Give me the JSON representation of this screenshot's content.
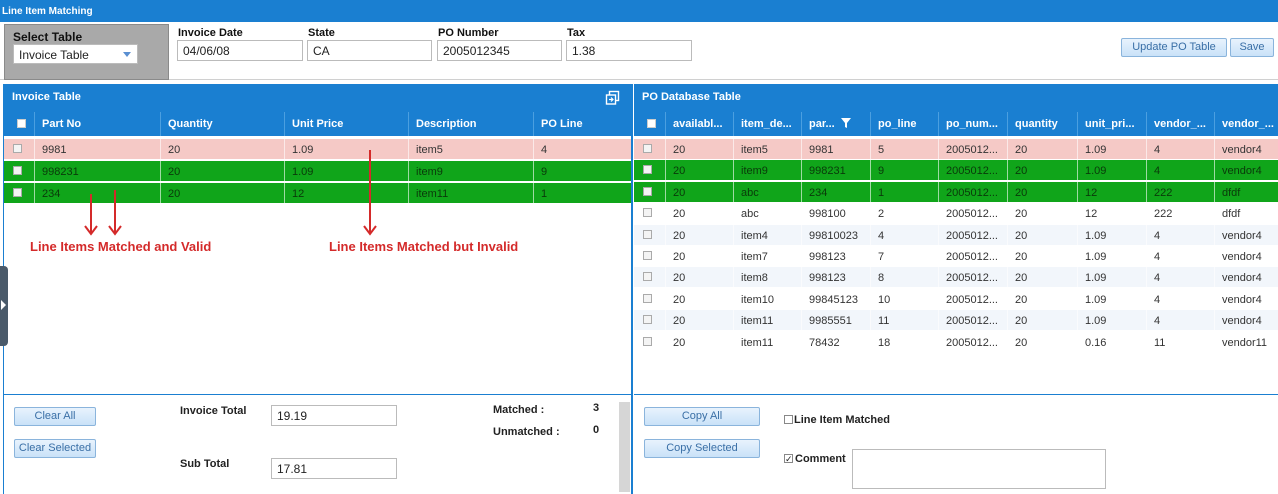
{
  "window": {
    "title": "Line Item Matching"
  },
  "select_table": {
    "label": "Select Table",
    "value": "Invoice Table"
  },
  "fields": {
    "invoice_date": {
      "label": "Invoice Date",
      "value": "04/06/08"
    },
    "state": {
      "label": "State",
      "value": "CA"
    },
    "po_number": {
      "label": "PO Number",
      "value": "2005012345"
    },
    "tax": {
      "label": "Tax",
      "value": "1.38"
    }
  },
  "toolbar": {
    "update_po_label": "Update PO Table",
    "save_label": "Save"
  },
  "invoice_table": {
    "title": "Invoice Table",
    "columns": [
      "Part No",
      "Quantity",
      "Unit Price",
      "Description",
      "PO Line"
    ],
    "rows": [
      {
        "state": "pink",
        "cells": [
          "9981",
          "20",
          "1.09",
          "item5",
          "4"
        ]
      },
      {
        "state": "green",
        "cells": [
          "998231",
          "20",
          "1.09",
          "item9",
          "9"
        ]
      },
      {
        "state": "green",
        "cells": [
          "234",
          "20",
          "12",
          "item11",
          "1"
        ]
      }
    ]
  },
  "annotations": {
    "valid": "Line Items Matched and Valid",
    "invalid": "Line Items Matched but Invalid"
  },
  "po_table": {
    "title": "PO Database Table",
    "columns": [
      "availabl...",
      "item_de...",
      "par...",
      "po_line",
      "po_num...",
      "quantity",
      "unit_pri...",
      "vendor_...",
      "vendor_..."
    ],
    "rows": [
      {
        "state": "pink",
        "cells": [
          "20",
          "item5",
          "9981",
          "5",
          "2005012...",
          "20",
          "1.09",
          "4",
          "vendor4"
        ]
      },
      {
        "state": "green",
        "cells": [
          "20",
          "item9",
          "998231",
          "9",
          "2005012...",
          "20",
          "1.09",
          "4",
          "vendor4"
        ]
      },
      {
        "state": "green",
        "cells": [
          "20",
          "abc",
          "234",
          "1",
          "2005012...",
          "20",
          "12",
          "222",
          "dfdf"
        ]
      },
      {
        "state": "white",
        "cells": [
          "20",
          "abc",
          "998100",
          "2",
          "2005012...",
          "20",
          "12",
          "222",
          "dfdf"
        ]
      },
      {
        "state": "alt",
        "cells": [
          "20",
          "item4",
          "99810023",
          "4",
          "2005012...",
          "20",
          "1.09",
          "4",
          "vendor4"
        ]
      },
      {
        "state": "white",
        "cells": [
          "20",
          "item7",
          "998123",
          "7",
          "2005012...",
          "20",
          "1.09",
          "4",
          "vendor4"
        ]
      },
      {
        "state": "alt",
        "cells": [
          "20",
          "item8",
          "998123",
          "8",
          "2005012...",
          "20",
          "1.09",
          "4",
          "vendor4"
        ]
      },
      {
        "state": "white",
        "cells": [
          "20",
          "item10",
          "99845123",
          "10",
          "2005012...",
          "20",
          "1.09",
          "4",
          "vendor4"
        ]
      },
      {
        "state": "alt",
        "cells": [
          "20",
          "item11",
          "9985551",
          "11",
          "2005012...",
          "20",
          "1.09",
          "4",
          "vendor4"
        ]
      },
      {
        "state": "white",
        "cells": [
          "20",
          "item11",
          "78432",
          "18",
          "2005012...",
          "20",
          "0.16",
          "11",
          "vendor11"
        ]
      }
    ]
  },
  "invoice_footer": {
    "clear_all_label": "Clear All",
    "clear_selected_label": "Clear Selected",
    "invoice_total_label": "Invoice Total",
    "invoice_total_value": "19.19",
    "sub_total_label": "Sub Total",
    "sub_total_value": "17.81",
    "matched_label": "Matched :",
    "matched_value": "3",
    "unmatched_label": "Unmatched :",
    "unmatched_value": "0"
  },
  "po_footer": {
    "copy_all_label": "Copy All",
    "copy_selected_label": "Copy Selected",
    "line_item_matched_label": "Line Item Matched",
    "comment_label": "Comment",
    "comment_value": ""
  },
  "icons": {
    "copy": "copy-icon",
    "filter": "filter-icon",
    "dropdown": "chevron-down-icon",
    "side": "chevron-right-icon"
  },
  "colors": {
    "header_blue": "#1a7fd1",
    "matched_valid": "#10a51a",
    "matched_invalid": "#f5c9c6",
    "annotation_red": "#d42a2a"
  }
}
